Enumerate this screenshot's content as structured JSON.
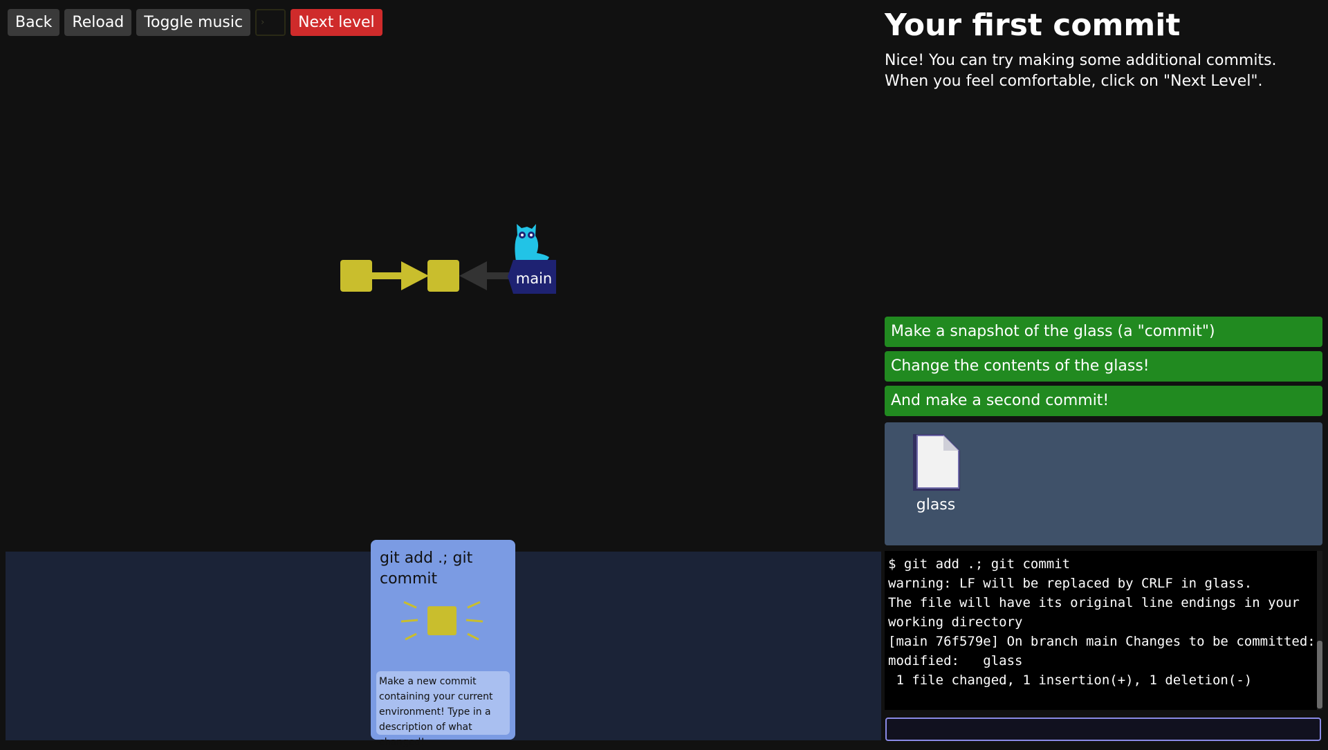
{
  "toolbar": {
    "back_label": "Back",
    "reload_label": "Reload",
    "music_label": "Toggle music",
    "terminal_icon": "terminal-icon",
    "next_label": "Next level",
    "next_color": "#cf2b2b"
  },
  "level": {
    "title": "Your first commit",
    "description": "Nice! You can try making some additional commits. When you feel comfortable, click on \"Next Level\"."
  },
  "graph": {
    "commit_color": "#c9be2d",
    "branch_label": "main",
    "branch_color": "#1e2272",
    "head_icon": "cat-mascot-icon",
    "commits": 2
  },
  "goals": [
    {
      "label": "Make a snapshot of the glass (a \"commit\")"
    },
    {
      "label": "Change the contents of the glass!"
    },
    {
      "label": "And make a second commit!"
    }
  ],
  "goal_color": "#218a20",
  "files": [
    {
      "name": "glass",
      "icon": "file-icon"
    }
  ],
  "card": {
    "title": "git add .; git commit",
    "icon": "commit-sparkle-icon",
    "description": "Make a new commit containing your current environment! Type in a description of what changed!"
  },
  "terminal": {
    "lines": [
      "$ git add .; git commit",
      "warning: LF will be replaced by CRLF in glass.",
      "The file will have its original line endings in your",
      "working directory",
      "[main 76f579e] On branch main Changes to be committed:",
      "modified:   glass",
      " 1 file changed, 1 insertion(+), 1 deletion(-)"
    ],
    "input_value": ""
  }
}
